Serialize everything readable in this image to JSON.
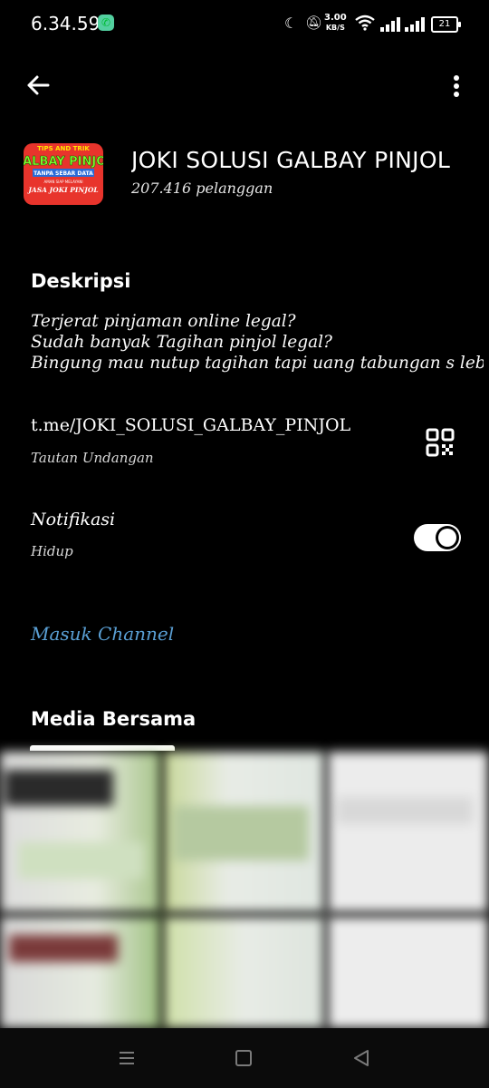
{
  "status_bar": {
    "time": "6.34.59",
    "net_speed_value": "3.00",
    "net_speed_unit": "KB/S",
    "battery": "21"
  },
  "channel": {
    "title": "JOKI SOLUSI GALBAY PINJOL",
    "subscribers": "207.416 pelanggan",
    "avatar_text": {
      "line1": "TIPS AND TRIK",
      "line2": "GALBAY PINJOL",
      "line3": "TANPA SEBAR DATA",
      "line4": "AMAN SIAP MELAYANI",
      "line5": "JASA JOKI PINJOL"
    }
  },
  "description": {
    "heading": "Deskripsi",
    "lines": [
      "Terjerat pinjaman online legal?",
      "Sudah banyak Tagihan pinjol legal?",
      "Bingung mau nutup tagihan tapi uang tabungan s  lebih"
    ]
  },
  "invite": {
    "link": "t.me/JOKI_SOLUSI_GALBAY_PINJOL",
    "label": "Tautan Undangan"
  },
  "notifications": {
    "label": "Notifikasi",
    "state": "Hidup",
    "enabled": true
  },
  "join_label": "Masuk Channel",
  "media": {
    "heading": "Media Bersama"
  },
  "colors": {
    "background": "#000000",
    "link_blue": "#5a9fd4",
    "avatar_red": "#e8342c"
  },
  "icons": [
    "back-arrow-icon",
    "more-vert-icon",
    "qr-code-icon",
    "moon-icon",
    "bell-off-icon",
    "wifi-icon",
    "signal-icon",
    "battery-icon",
    "call-icon"
  ]
}
